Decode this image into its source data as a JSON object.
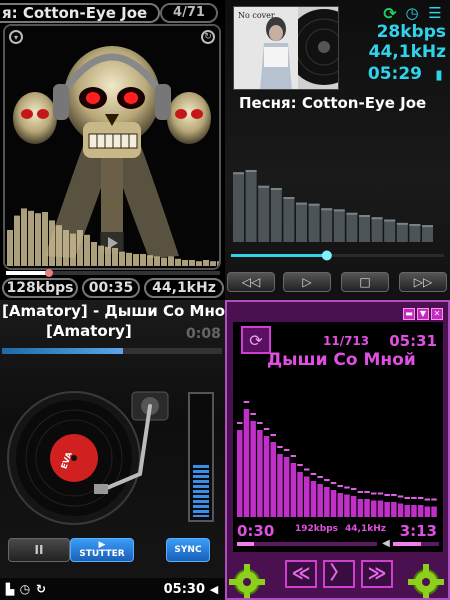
{
  "player1": {
    "title": "я: Cotton-Eye Joe",
    "track_count": "4/71",
    "bitrate": "128kbps",
    "time": "00:35",
    "sample_rate": "44,1kHz",
    "progress": 0.2,
    "spectrum": [
      0.3,
      0.42,
      0.48,
      0.46,
      0.44,
      0.45,
      0.38,
      0.34,
      0.3,
      0.27,
      0.3,
      0.26,
      0.2,
      0.17,
      0.16,
      0.15,
      0.12,
      0.11,
      0.1,
      0.1,
      0.09,
      0.08,
      0.07,
      0.08,
      0.06,
      0.05,
      0.05,
      0.04,
      0.05,
      0.04,
      0.04
    ],
    "accent": "#7a6a4a"
  },
  "player2": {
    "cover_text": "No cover",
    "bitrate": "28kbps",
    "sample_rate": "44,1kHz",
    "time": "05:29",
    "song": "Песня: Cotton-Eye Joe",
    "progress": 0.45,
    "spectrum": [
      0.62,
      0.64,
      0.5,
      0.48,
      0.4,
      0.35,
      0.34,
      0.3,
      0.29,
      0.26,
      0.24,
      0.22,
      0.2,
      0.17,
      0.16,
      0.15
    ],
    "buttons": [
      "◁◁",
      "▷",
      "□",
      "▷▷"
    ],
    "accent": "#2fd4ec"
  },
  "player3": {
    "title_line1": "[Amatory] - Дыши Со Мной",
    "title_line2": "[Amatory]",
    "title_time": "0:08",
    "progress": 0.55,
    "record_label": "EVA",
    "level": 0.42,
    "pause_label": "II",
    "stutter_label": "STUTTER",
    "stutter_icon": "▶",
    "sync_label": "SYNC",
    "status_time": "05:30",
    "accent": "#2a7dd8"
  },
  "player4": {
    "track_count": "11/713",
    "clock": "05:31",
    "song": "Дыши Со Мной",
    "elapsed": "0:30",
    "bitrate": "192kbps",
    "sample_rate": "44,1kHz",
    "remaining": "3:13",
    "progress": 0.12,
    "volume": 0.6,
    "spectrum": [
      0.58,
      0.72,
      0.64,
      0.58,
      0.54,
      0.5,
      0.42,
      0.4,
      0.36,
      0.3,
      0.27,
      0.24,
      0.22,
      0.2,
      0.18,
      0.16,
      0.15,
      0.14,
      0.12,
      0.12,
      0.11,
      0.11,
      0.1,
      0.1,
      0.09,
      0.08,
      0.08,
      0.08,
      0.07,
      0.07
    ],
    "nav_buttons": [
      "≪",
      "〉",
      "≫"
    ],
    "window_buttons": [
      "▬",
      "▼",
      "✕"
    ],
    "accent": "#e050e0"
  }
}
